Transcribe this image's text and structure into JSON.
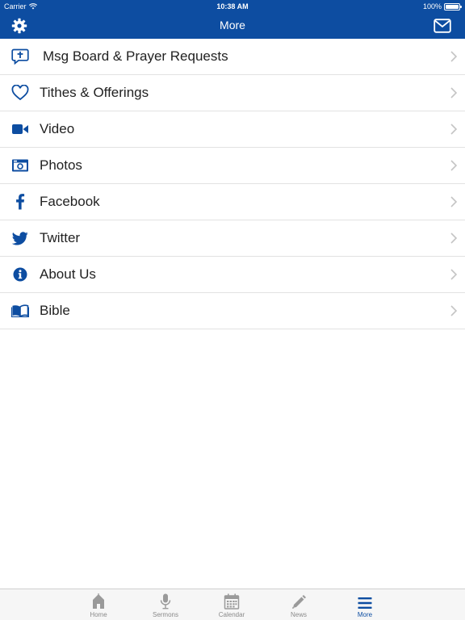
{
  "status": {
    "carrier": "Carrier",
    "time": "10:38 AM",
    "battery": "100%"
  },
  "nav": {
    "title": "More"
  },
  "menu": [
    {
      "label": "Msg Board & Prayer Requests",
      "icon": "message-cross-icon"
    },
    {
      "label": "Tithes & Offerings",
      "icon": "heart-icon"
    },
    {
      "label": "Video",
      "icon": "video-camera-icon"
    },
    {
      "label": "Photos",
      "icon": "camera-icon"
    },
    {
      "label": "Facebook",
      "icon": "facebook-icon"
    },
    {
      "label": "Twitter",
      "icon": "twitter-icon"
    },
    {
      "label": "About Us",
      "icon": "info-icon"
    },
    {
      "label": "Bible",
      "icon": "book-icon"
    }
  ],
  "tabs": [
    {
      "label": "Home",
      "icon": "home-icon"
    },
    {
      "label": "Sermons",
      "icon": "microphone-icon"
    },
    {
      "label": "Calendar",
      "icon": "calendar-icon"
    },
    {
      "label": "News",
      "icon": "pencil-icon"
    },
    {
      "label": "More",
      "icon": "menu-icon",
      "active": true
    }
  ],
  "colors": {
    "brand": "#0d4da1",
    "tab_inactive": "#8a8a8a",
    "separator": "#e2e2e2"
  }
}
